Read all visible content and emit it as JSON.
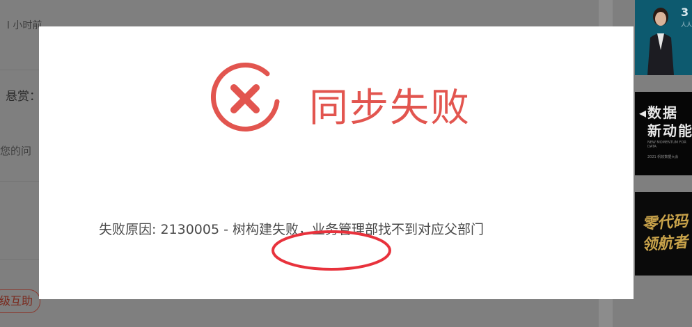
{
  "background": {
    "time_text": "l 小时前",
    "reward_text": "悬赏：",
    "question_text": "您的问",
    "tag_text": "级互助"
  },
  "ads": {
    "ad1_headline": "3",
    "ad1_sub": "人人",
    "ad2_line1": "数据",
    "ad2_line2": "新动能",
    "ad2_en": "NEW MOMENTUM FOR DATA",
    "ad2_event": "2021 帆软数据大会",
    "ad3_line1": "零代码",
    "ad3_line2": "领航者"
  },
  "modal": {
    "title": "同步失败",
    "reason": "失败原因: 2130005",
    "reason_highlight": " - 树构建失败，",
    "reason_tail": "业务管理部找不到对应父部门",
    "status_color": "#e2554f",
    "annotation_color": "#e8323c"
  }
}
